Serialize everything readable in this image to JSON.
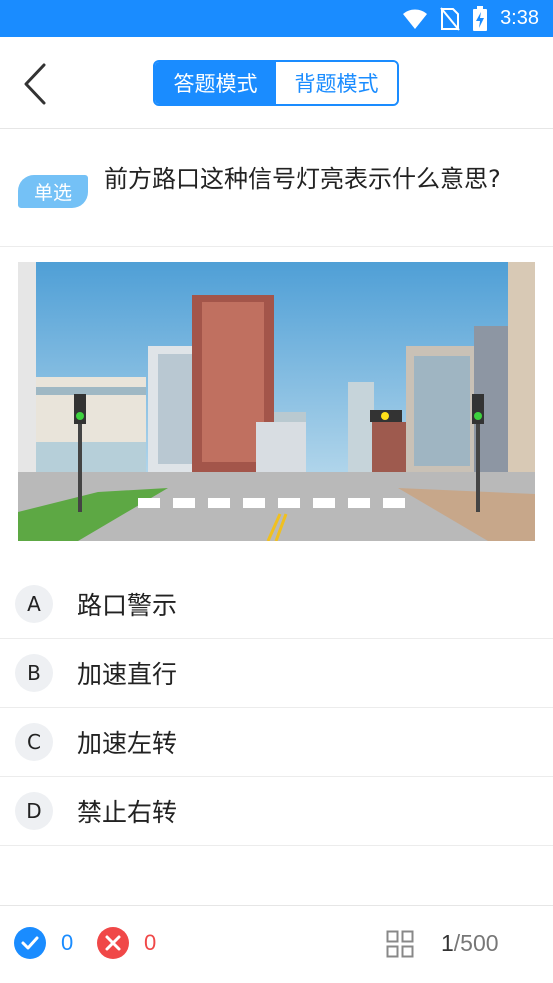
{
  "status_bar": {
    "time": "3:38",
    "icons": [
      "wifi-icon",
      "no-sim-icon",
      "battery-charging-icon"
    ]
  },
  "header": {
    "back_icon": "chevron-left-icon",
    "modes": [
      {
        "label": "答题模式",
        "active": true
      },
      {
        "label": "背题模式",
        "active": false
      }
    ]
  },
  "question": {
    "type_tag": "单选",
    "text": "前方路口这种信号灯亮表示什么意思?"
  },
  "options": [
    {
      "letter": "A",
      "text": "路口警示"
    },
    {
      "letter": "B",
      "text": "加速直行"
    },
    {
      "letter": "C",
      "text": "加速左转"
    },
    {
      "letter": "D",
      "text": "禁止右转"
    }
  ],
  "footer": {
    "correct_count": "0",
    "wrong_count": "0",
    "grid_icon": "grid-icon",
    "current": "1",
    "total": "/500"
  },
  "colors": {
    "accent": "#1a8cff",
    "correct": "#1a8cff",
    "wrong": "#f04848",
    "tag": "#74c1f6"
  }
}
